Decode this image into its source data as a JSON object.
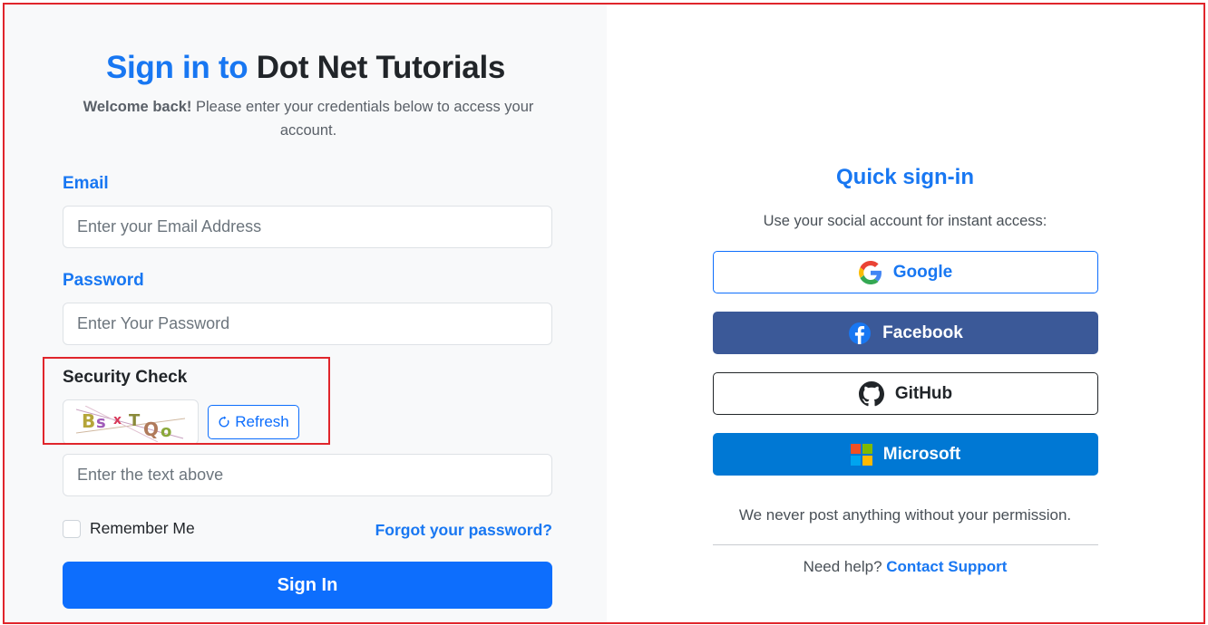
{
  "login": {
    "title_accent": "Sign in to",
    "title_rest": "Dot Net Tutorials",
    "subtitle_bold": "Welcome back!",
    "subtitle_rest": "Please enter your credentials below to access your account.",
    "email_label": "Email",
    "email_placeholder": "Enter your Email Address",
    "password_label": "Password",
    "password_placeholder": "Enter Your Password",
    "security_label": "Security Check",
    "captcha_text": "BsxTQo",
    "refresh_label": "Refresh",
    "captcha_placeholder": "Enter the text above",
    "remember_label": "Remember Me",
    "forgot_label": "Forgot your password?",
    "signin_label": "Sign In"
  },
  "quick": {
    "title": "Quick sign-in",
    "subtitle": "Use your social account for instant access:",
    "providers": [
      {
        "label": "Google",
        "icon": "google-icon"
      },
      {
        "label": "Facebook",
        "icon": "facebook-icon"
      },
      {
        "label": "GitHub",
        "icon": "github-icon"
      },
      {
        "label": "Microsoft",
        "icon": "microsoft-icon"
      }
    ],
    "disclaimer": "We never post anything without your permission.",
    "help_prefix": "Need help?",
    "help_link": "Contact Support"
  },
  "colors": {
    "accent": "#1877f2",
    "primary_button": "#0d6efd",
    "facebook": "#3b5998",
    "microsoft": "#0078d4",
    "highlight_border": "#e0252b"
  }
}
